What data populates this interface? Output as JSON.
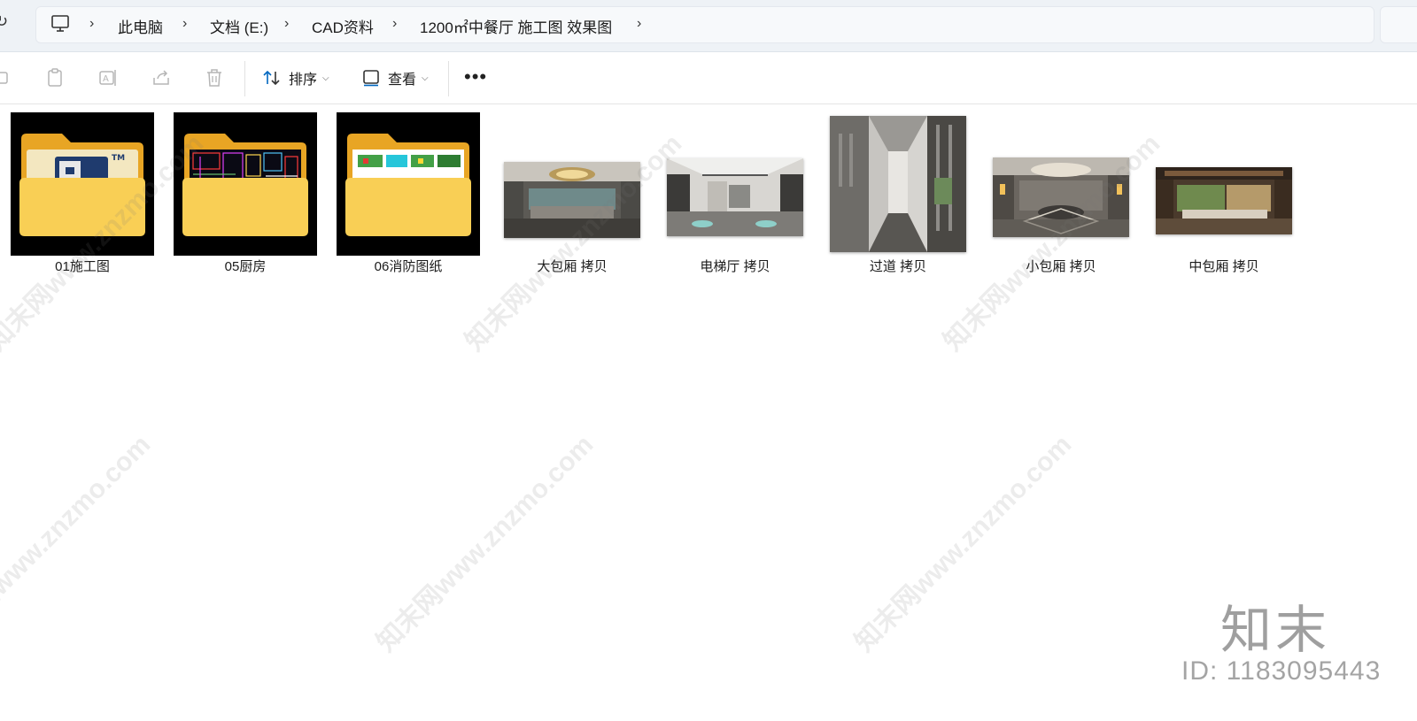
{
  "address_bar": {
    "crumbs": [
      "此电脑",
      "文档 (E:)",
      "CAD资料",
      "1200㎡中餐厅 施工图 效果图"
    ]
  },
  "toolbar": {
    "sort_label": "排序",
    "view_label": "查看",
    "more_label": "•••"
  },
  "files": [
    {
      "name": "01施工图",
      "kind": "folder"
    },
    {
      "name": "05厨房",
      "kind": "folder"
    },
    {
      "name": "06消防图纸",
      "kind": "folder"
    },
    {
      "name": "大包厢 拷贝",
      "kind": "image"
    },
    {
      "name": "电梯厅 拷贝",
      "kind": "image"
    },
    {
      "name": "过道 拷贝",
      "kind": "image"
    },
    {
      "name": "小包厢 拷贝",
      "kind": "image"
    },
    {
      "name": "中包厢 拷贝",
      "kind": "image"
    }
  ],
  "watermark": {
    "text": "知末网www.znzmo.com",
    "brand": "知末",
    "id": "ID: 1183095443"
  },
  "colors": {
    "folder_yellow": "#f7c948",
    "folder_back": "#e8a524",
    "accent": "#0067c0"
  }
}
